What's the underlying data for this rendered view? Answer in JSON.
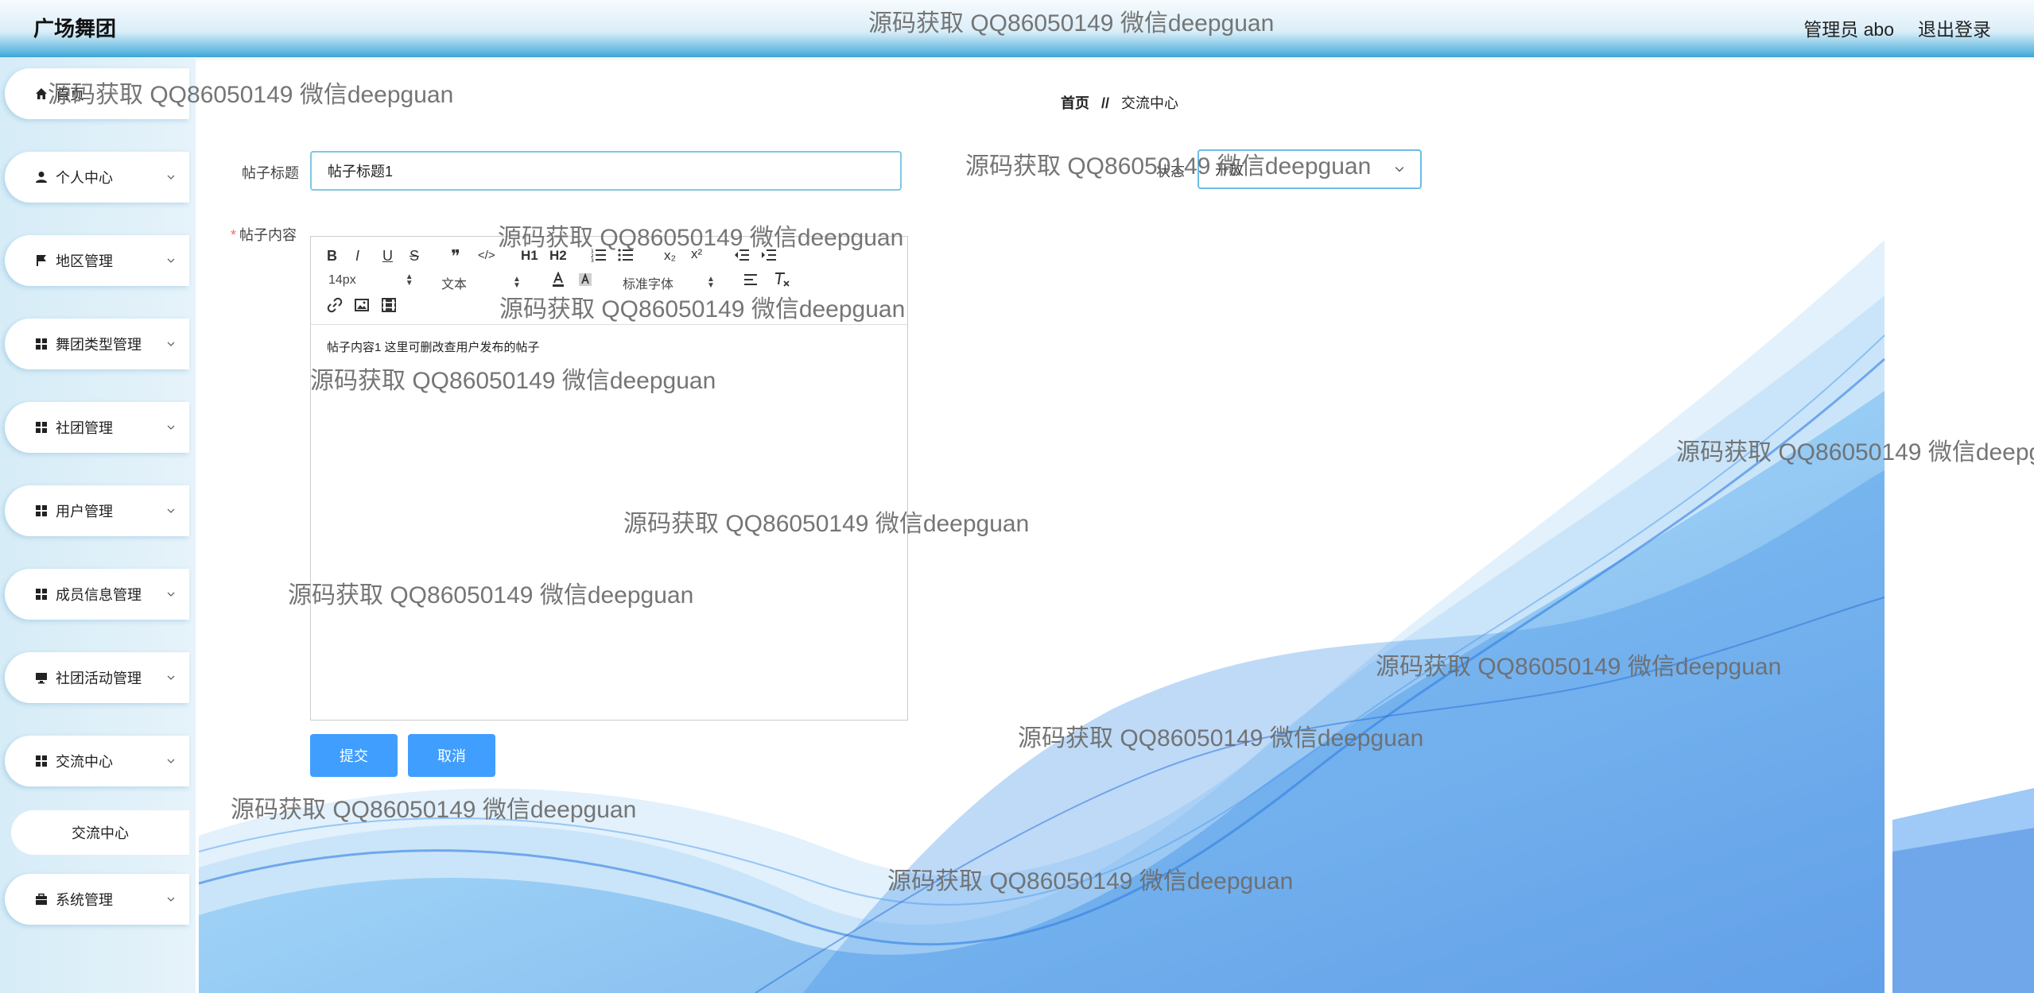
{
  "header": {
    "brand": "广场舞团",
    "admin_label": "管理员 abo",
    "logout_label": "退出登录"
  },
  "sidebar": {
    "items": [
      {
        "label": "首页",
        "icon": "home-icon"
      },
      {
        "label": "个人中心",
        "icon": "user-icon"
      },
      {
        "label": "地区管理",
        "icon": "flag-icon"
      },
      {
        "label": "舞团类型管理",
        "icon": "grid-icon"
      },
      {
        "label": "社团管理",
        "icon": "grid-icon"
      },
      {
        "label": "用户管理",
        "icon": "grid-icon"
      },
      {
        "label": "成员信息管理",
        "icon": "grid-icon"
      },
      {
        "label": "社团活动管理",
        "icon": "monitor-icon"
      },
      {
        "label": "交流中心",
        "icon": "grid-icon"
      },
      {
        "label": "系统管理",
        "icon": "briefcase-icon"
      }
    ],
    "sub_item": "交流中心"
  },
  "breadcrumb": {
    "home": "首页",
    "separator": "//",
    "current": "交流中心"
  },
  "form": {
    "title_label": "帖子标题",
    "title_value": "帖子标题1",
    "status_label": "状态",
    "status_value": "开放",
    "content_label": "帖子内容",
    "content_required_mark": "*",
    "content_value": "帖子内容1 这里可删改查用户发布的帖子"
  },
  "editor_toolbar": {
    "bold": "B",
    "italic": "I",
    "underline": "U",
    "strike": "S",
    "quote": "❞",
    "code": "</>",
    "h1": "H1",
    "h2": "H2",
    "sub": "x₂",
    "sup": "x²",
    "size_value": "14px",
    "header_value": "文本",
    "font_value": "标准字体"
  },
  "buttons": {
    "submit": "提交",
    "cancel": "取消"
  },
  "watermark": "源码获取 QQ86050149 微信deepguan",
  "colors": {
    "accent": "#409eff",
    "input_border": "#7ec8e3",
    "header_gradient_end": "#3aa3d6",
    "wave": "#1e88e5"
  }
}
